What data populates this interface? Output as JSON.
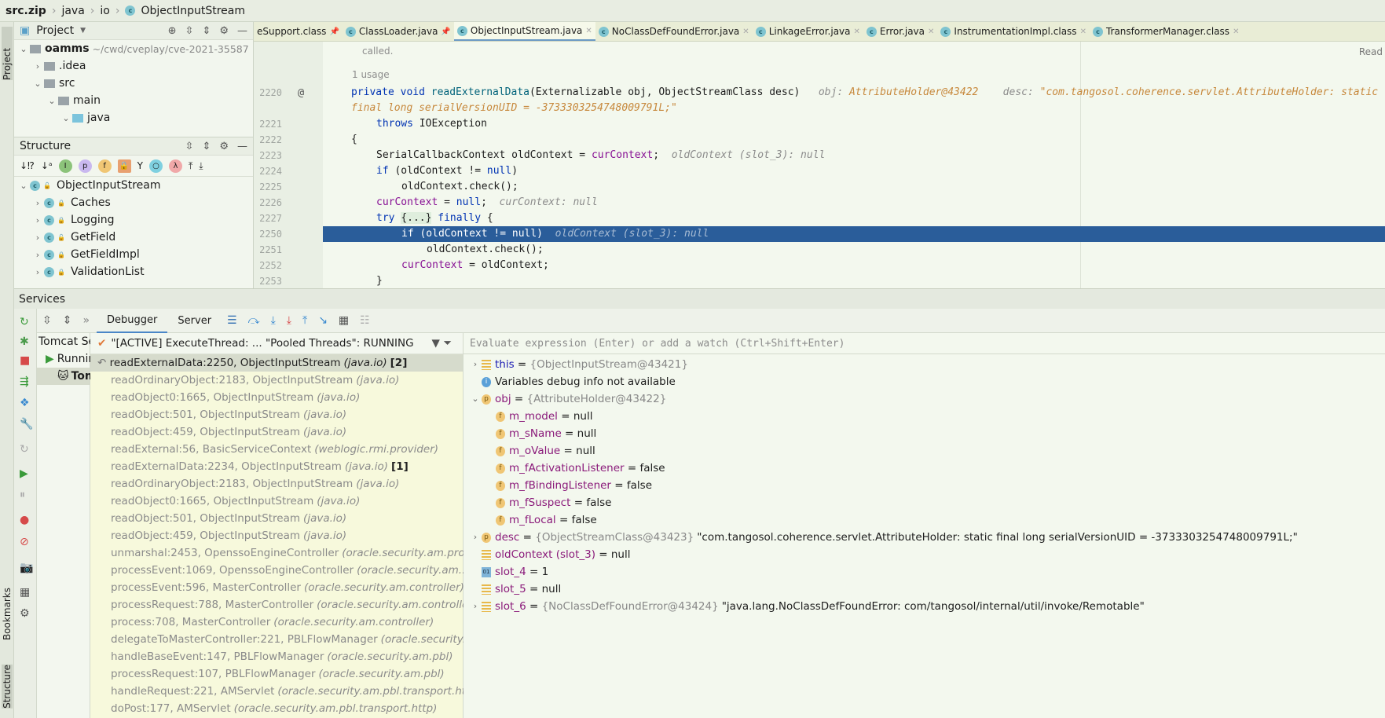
{
  "breadcrumb": [
    "src.zip",
    "java",
    "io",
    "ObjectInputStream"
  ],
  "left_strip": {
    "project": "Project",
    "bookmarks": "Bookmarks",
    "structure": "Structure"
  },
  "project": {
    "title": "Project",
    "items": [
      {
        "label": "oamms",
        "hint": "~/cwd/cveplay/cve-2021-35587",
        "depth": 0,
        "open": true
      },
      {
        "label": ".idea",
        "depth": 1,
        "open": false
      },
      {
        "label": "src",
        "depth": 1,
        "open": true
      },
      {
        "label": "main",
        "depth": 2,
        "open": true
      },
      {
        "label": "java",
        "depth": 3,
        "open": true
      }
    ]
  },
  "structure": {
    "title": "Structure",
    "items": [
      {
        "label": "ObjectInputStream",
        "depth": 0,
        "open": true
      },
      {
        "label": "Caches",
        "depth": 1
      },
      {
        "label": "Logging",
        "depth": 1
      },
      {
        "label": "GetField",
        "depth": 1
      },
      {
        "label": "GetFieldImpl",
        "depth": 1
      },
      {
        "label": "ValidationList",
        "depth": 1
      }
    ]
  },
  "editor": {
    "tabs": [
      {
        "label": "eSupport.class",
        "pinned": true
      },
      {
        "label": "ClassLoader.java",
        "pinned": true
      },
      {
        "label": "ObjectInputStream.java",
        "active": true
      },
      {
        "label": "NoClassDefFoundError.java"
      },
      {
        "label": "LinkageError.java"
      },
      {
        "label": "Error.java"
      },
      {
        "label": "InstrumentationImpl.class"
      },
      {
        "label": "TransformerManager.class"
      }
    ],
    "doc_tail": "called.",
    "usage": "1 usage",
    "reader_mode": "Read",
    "lines": [
      {
        "n": "2220",
        "indent": 0,
        "tokens": [
          [
            "private void ",
            "kw"
          ],
          [
            "readExternalData",
            "fn"
          ],
          [
            "(Externalizable obj, ObjectStreamClass desc)",
            ""
          ],
          [
            "   obj: ",
            "hint"
          ],
          [
            "AttributeHolder@43422",
            "hintv"
          ],
          [
            "    desc: ",
            "hint"
          ],
          [
            "\"com.tangosol.coherence.servlet.AttributeHolder: static final long serialVersionUID = -3733303254748009791L;\"",
            "hintv"
          ]
        ]
      },
      {
        "n": "2221",
        "indent": 1,
        "tokens": [
          [
            "throws ",
            "kw"
          ],
          [
            "IOException",
            ""
          ]
        ]
      },
      {
        "n": "2222",
        "indent": 0,
        "tokens": [
          [
            "{",
            ""
          ]
        ]
      },
      {
        "n": "2223",
        "indent": 1,
        "tokens": [
          [
            "SerialCallbackContext oldContext = ",
            ""
          ],
          [
            "curContext",
            "fld"
          ],
          [
            ";",
            ""
          ],
          [
            "  oldContext (slot_3): null",
            "hint"
          ]
        ]
      },
      {
        "n": "2224",
        "indent": 1,
        "tokens": [
          [
            "if ",
            "kw"
          ],
          [
            "(oldContext != ",
            ""
          ],
          [
            "null",
            "kw"
          ],
          [
            ")",
            ""
          ]
        ]
      },
      {
        "n": "2225",
        "indent": 2,
        "tokens": [
          [
            "oldContext.check();",
            ""
          ]
        ]
      },
      {
        "n": "2226",
        "indent": 1,
        "tokens": [
          [
            "curContext",
            "fld"
          ],
          [
            " = ",
            ""
          ],
          [
            "null",
            "kw"
          ],
          [
            ";",
            ""
          ],
          [
            "  curContext: null",
            "hint"
          ]
        ]
      },
      {
        "n": "2227",
        "indent": 1,
        "tokens": [
          [
            "try ",
            "kw"
          ],
          [
            "{...}",
            "fold"
          ],
          [
            " finally ",
            "kw"
          ],
          [
            "{",
            ""
          ]
        ]
      },
      {
        "n": "2250",
        "indent": 2,
        "selected": true,
        "tokens": [
          [
            "if (oldContext != null)",
            ""
          ],
          [
            "  oldContext (slot_3): null",
            "hint"
          ]
        ]
      },
      {
        "n": "2251",
        "indent": 3,
        "tokens": [
          [
            "oldContext.check();",
            ""
          ]
        ]
      },
      {
        "n": "2252",
        "indent": 2,
        "tokens": [
          [
            "curContext",
            "fld"
          ],
          [
            " = oldContext;",
            ""
          ]
        ]
      },
      {
        "n": "2253",
        "indent": 1,
        "tokens": [
          [
            "}",
            ""
          ]
        ]
      }
    ]
  },
  "services": {
    "title": "Services",
    "tabs": [
      "Debugger",
      "Server"
    ],
    "tree": [
      "Tomcat Server",
      "Running",
      "Tomcat"
    ],
    "thread": "\"[ACTIVE] ExecuteThread: ... \"Pooled Threads\": RUNNING",
    "frames": [
      [
        "readExternalData:2250, ObjectInputStream",
        "(java.io)",
        "[2]"
      ],
      [
        "readOrdinaryObject:2183, ObjectInputStream",
        "(java.io)",
        ""
      ],
      [
        "readObject0:1665, ObjectInputStream",
        "(java.io)",
        ""
      ],
      [
        "readObject:501, ObjectInputStream",
        "(java.io)",
        ""
      ],
      [
        "readObject:459, ObjectInputStream",
        "(java.io)",
        ""
      ],
      [
        "readExternal:56, BasicServiceContext",
        "(weblogic.rmi.provider)",
        ""
      ],
      [
        "readExternalData:2234, ObjectInputStream",
        "(java.io)",
        "[1]"
      ],
      [
        "readOrdinaryObject:2183, ObjectInputStream",
        "(java.io)",
        ""
      ],
      [
        "readObject0:1665, ObjectInputStream",
        "(java.io)",
        ""
      ],
      [
        "readObject:501, ObjectInputStream",
        "(java.io)",
        ""
      ],
      [
        "readObject:459, ObjectInputStream",
        "(java.io)",
        ""
      ],
      [
        "unmarshal:2453, OpenssoEngineController",
        "(oracle.security.am.proxy...)",
        ""
      ],
      [
        "processEvent:1069, OpenssoEngineController",
        "(oracle.security.am...)",
        ""
      ],
      [
        "processEvent:596, MasterController",
        "(oracle.security.am.controller)",
        ""
      ],
      [
        "processRequest:788, MasterController",
        "(oracle.security.am.controller)",
        ""
      ],
      [
        "process:708, MasterController",
        "(oracle.security.am.controller)",
        ""
      ],
      [
        "delegateToMasterController:221, PBLFlowManager",
        "(oracle.security...)",
        ""
      ],
      [
        "handleBaseEvent:147, PBLFlowManager",
        "(oracle.security.am.pbl)",
        ""
      ],
      [
        "processRequest:107, PBLFlowManager",
        "(oracle.security.am.pbl)",
        ""
      ],
      [
        "handleRequest:221, AMServlet",
        "(oracle.security.am.pbl.transport.http)",
        ""
      ],
      [
        "doPost:177, AMServlet",
        "(oracle.security.am.pbl.transport.http)",
        ""
      ]
    ],
    "eval_placeholder": "Evaluate expression (Enter) or add a watch (Ctrl+Shift+Enter)",
    "variables": [
      {
        "icon": "eq",
        "exp": "closed",
        "name": "this",
        "type": "{ObjectInputStream@43421}",
        "value": "",
        "depth": 0
      },
      {
        "icon": "info",
        "name": "Variables debug info not available",
        "depth": 0,
        "plain": true
      },
      {
        "icon": "p",
        "exp": "open",
        "name": "obj",
        "type": "{AttributeHolder@43422}",
        "value": "",
        "depth": 0
      },
      {
        "icon": "f",
        "name": "m_model",
        "value": "null",
        "depth": 1
      },
      {
        "icon": "f",
        "name": "m_sName",
        "value": "null",
        "depth": 1
      },
      {
        "icon": "f",
        "name": "m_oValue",
        "value": "null",
        "depth": 1
      },
      {
        "icon": "f",
        "name": "m_fActivationListener",
        "value": "false",
        "depth": 1
      },
      {
        "icon": "f",
        "name": "m_fBindingListener",
        "value": "false",
        "depth": 1
      },
      {
        "icon": "f",
        "name": "m_fSuspect",
        "value": "false",
        "depth": 1
      },
      {
        "icon": "f",
        "name": "m_fLocal",
        "value": "false",
        "depth": 1
      },
      {
        "icon": "p",
        "exp": "closed",
        "name": "desc",
        "type": "{ObjectStreamClass@43423}",
        "value": "\"com.tangosol.coherence.servlet.AttributeHolder: static final long serialVersionUID = -3733303254748009791L;\"",
        "depth": 0
      },
      {
        "icon": "eq",
        "name": "oldContext (slot_3)",
        "value": "null",
        "depth": 0
      },
      {
        "icon": "num",
        "name": "slot_4",
        "value": "1",
        "depth": 0
      },
      {
        "icon": "eq",
        "name": "slot_5",
        "value": "null",
        "depth": 0
      },
      {
        "icon": "eq",
        "exp": "closed",
        "name": "slot_6",
        "type": "{NoClassDefFoundError@43424}",
        "value": "\"java.lang.NoClassDefFoundError: com/tangosol/internal/util/invoke/Remotable\"",
        "depth": 0
      }
    ]
  }
}
